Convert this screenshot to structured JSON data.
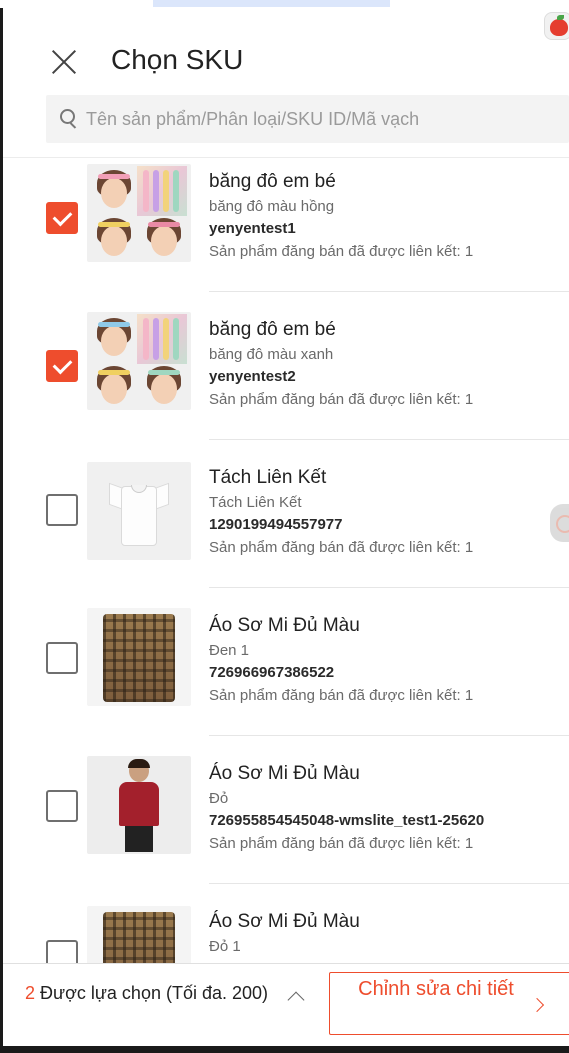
{
  "header": {
    "title": "Chọn SKU",
    "close_icon": "close-icon"
  },
  "search": {
    "placeholder": "Tên sản phẩm/Phân loại/SKU ID/Mã vạch"
  },
  "items": [
    {
      "name": "băng đô em bé",
      "variant": "băng đô màu hồng",
      "sku": "yenyentest1",
      "linked": "Sản phẩm đăng bán đã được liên kết: 1",
      "checked": true,
      "thumb": "headband-photo"
    },
    {
      "name": "băng đô em bé",
      "variant": "băng đô màu xanh",
      "sku": "yenyentest2",
      "linked": "Sản phẩm đăng bán đã được liên kết: 1",
      "checked": true,
      "thumb": "headband-photo"
    },
    {
      "name": "Tách Liên Kết",
      "variant": "Tách Liên Kết",
      "sku": "1290199494557977",
      "linked": "Sản phẩm đăng bán đã được liên kết: 1",
      "checked": false,
      "thumb": "white-tshirt-photo"
    },
    {
      "name": "Áo Sơ Mi Đủ Màu",
      "variant": "Đen 1",
      "sku": "726966967386522",
      "linked": "Sản phẩm đăng bán đã được liên kết: 1",
      "checked": false,
      "thumb": "plaid-shirt-photo"
    },
    {
      "name": "Áo Sơ Mi Đủ Màu",
      "variant": "Đỏ",
      "sku": "726955854545048-wmslite_test1-25620",
      "linked": "Sản phẩm đăng bán đã được liên kết: 1",
      "checked": false,
      "thumb": "red-shirt-model-photo"
    },
    {
      "name": "Áo Sơ Mi Đủ Màu",
      "variant": "Đỏ 1",
      "sku": "",
      "linked": "",
      "checked": false,
      "thumb": "plaid-shirt-photo"
    }
  ],
  "footer": {
    "selected_count": "2",
    "selected_text": " Được lựa chọn (Tối đa. 200)",
    "edit_button": "Chỉnh sửa chi tiết"
  },
  "colors": {
    "accent": "#ee4d2d",
    "text": "#222222",
    "muted": "#6a6a6a"
  }
}
